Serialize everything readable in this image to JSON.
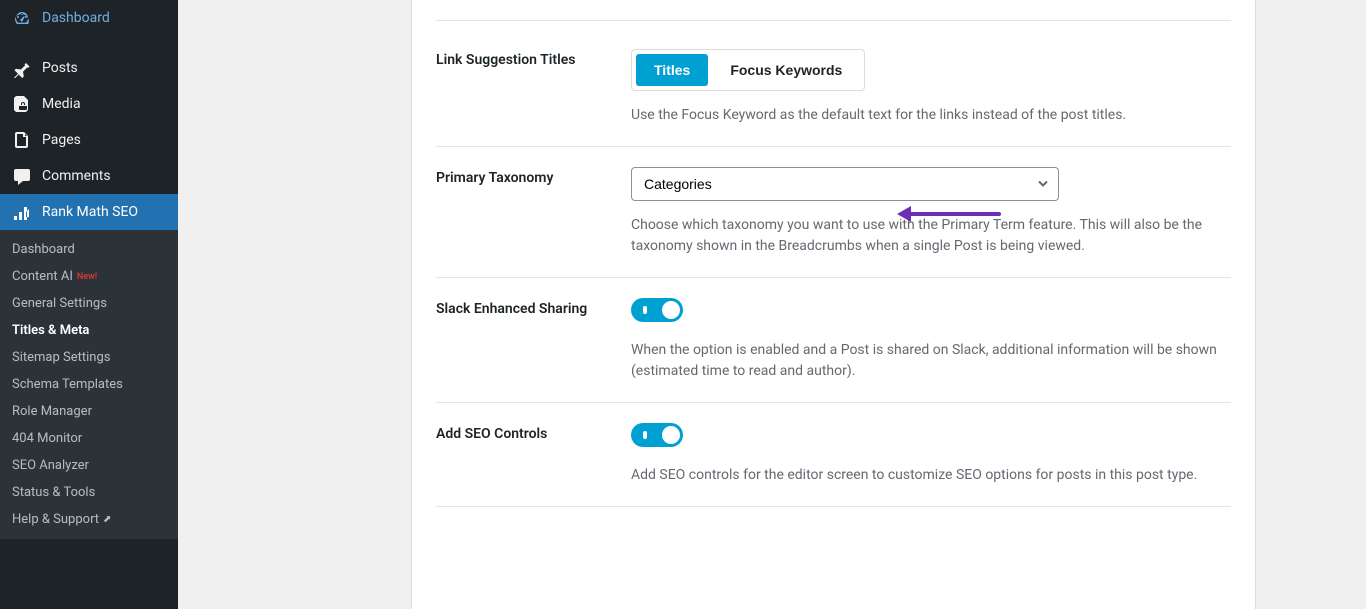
{
  "sidebar": {
    "main_items": [
      {
        "label": "Dashboard",
        "icon": "dashboard"
      },
      {
        "label": "Posts",
        "icon": "pin"
      },
      {
        "label": "Media",
        "icon": "media"
      },
      {
        "label": "Pages",
        "icon": "pages"
      },
      {
        "label": "Comments",
        "icon": "comments"
      },
      {
        "label": "Rank Math SEO",
        "icon": "rankmath",
        "active": true
      }
    ],
    "submenu": [
      {
        "label": "Dashboard"
      },
      {
        "label": "Content AI",
        "badge": "New!"
      },
      {
        "label": "General Settings"
      },
      {
        "label": "Titles & Meta",
        "current": true
      },
      {
        "label": "Sitemap Settings"
      },
      {
        "label": "Schema Templates"
      },
      {
        "label": "Role Manager"
      },
      {
        "label": "404 Monitor"
      },
      {
        "label": "SEO Analyzer"
      },
      {
        "label": "Status & Tools"
      },
      {
        "label": "Help & Support",
        "external": true
      }
    ]
  },
  "settings": {
    "link_suggestion": {
      "label": "Link Suggestion Titles",
      "btn_titles": "Titles",
      "btn_keywords": "Focus Keywords",
      "desc": "Use the Focus Keyword as the default text for the links instead of the post titles."
    },
    "primary_taxonomy": {
      "label": "Primary Taxonomy",
      "value": "Categories",
      "desc": "Choose which taxonomy you want to use with the Primary Term feature. This will also be the taxonomy shown in the Breadcrumbs when a single Post is being viewed."
    },
    "slack": {
      "label": "Slack Enhanced Sharing",
      "desc": "When the option is enabled and a Post is shared on Slack, additional information will be shown (estimated time to read and author)."
    },
    "seo_controls": {
      "label": "Add SEO Controls",
      "desc": "Add SEO controls for the editor screen to customize SEO options for posts in this post type."
    }
  }
}
